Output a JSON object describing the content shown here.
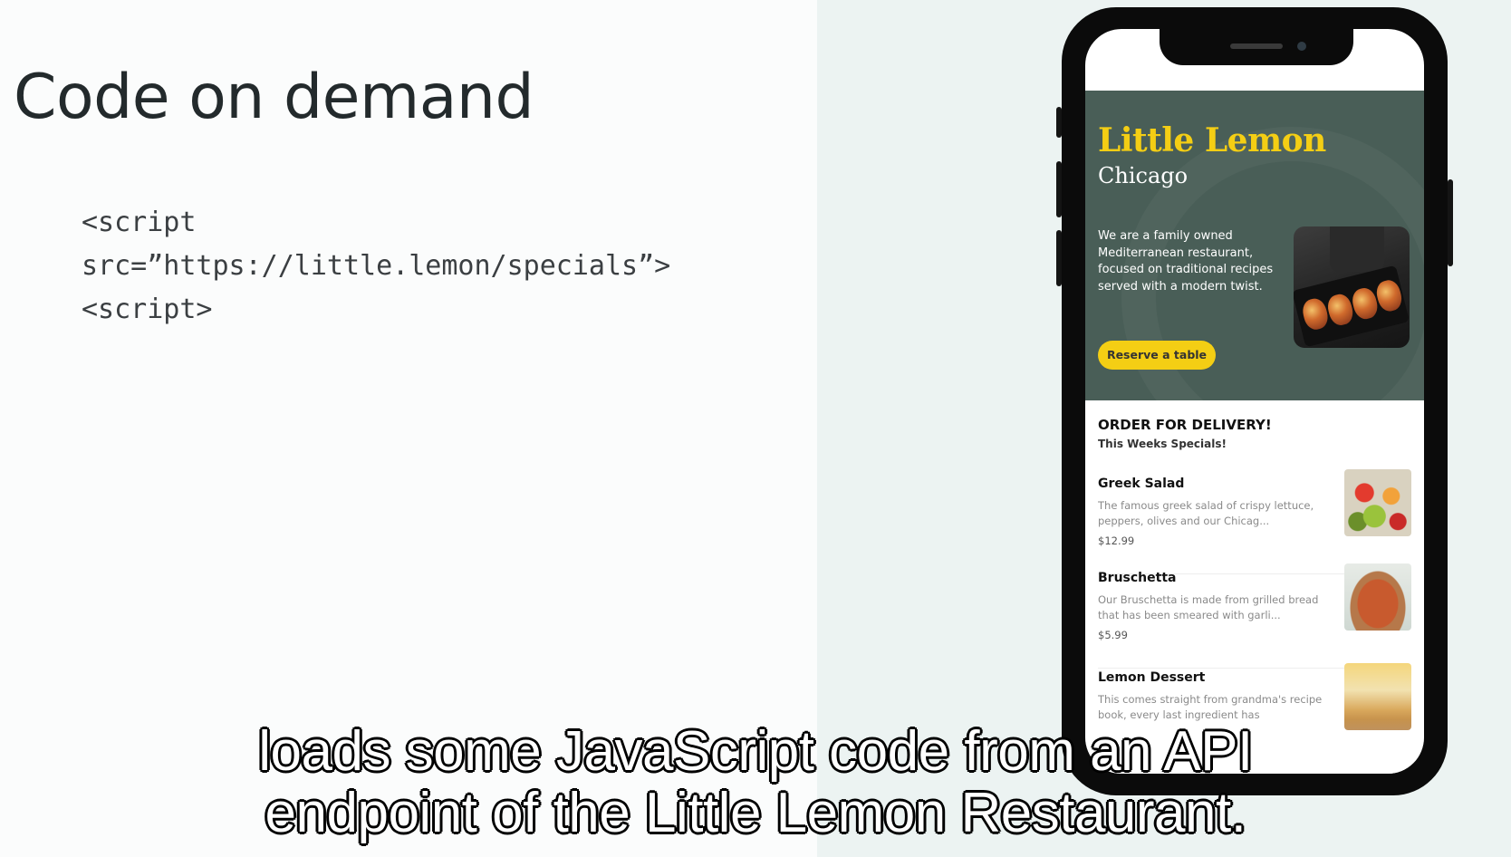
{
  "slide": {
    "title": "Code on demand",
    "code_lines": [
      "<script",
      "src=”https://little.lemon/specials”>",
      "<script>"
    ]
  },
  "phone_app": {
    "brand_title": "Little Lemon",
    "city": "Chicago",
    "description": "We are a family owned Mediterranean restaurant, focused on traditional recipes served with a modern twist.",
    "reserve_button": "Reserve a table",
    "delivery_heading": "ORDER FOR DELIVERY!",
    "delivery_subheading": "This Weeks Specials!",
    "menu_items": [
      {
        "name": "Greek Salad",
        "description": "The famous greek salad of crispy lettuce, peppers, olives and our Chicag...",
        "price": "$12.99"
      },
      {
        "name": "Bruschetta",
        "description": "Our Bruschetta is made from grilled bread that has been smeared with garli...",
        "price": "$5.99"
      },
      {
        "name": "Lemon Dessert",
        "description": "This comes straight from grandma's recipe book, every last ingredient has",
        "price": ""
      }
    ],
    "colors": {
      "hero_background": "#495e57",
      "brand_yellow": "#f4ce14"
    }
  },
  "caption": {
    "line1": "loads some JavaScript code from an API",
    "line2": "endpoint of the Little Lemon Restaurant."
  }
}
